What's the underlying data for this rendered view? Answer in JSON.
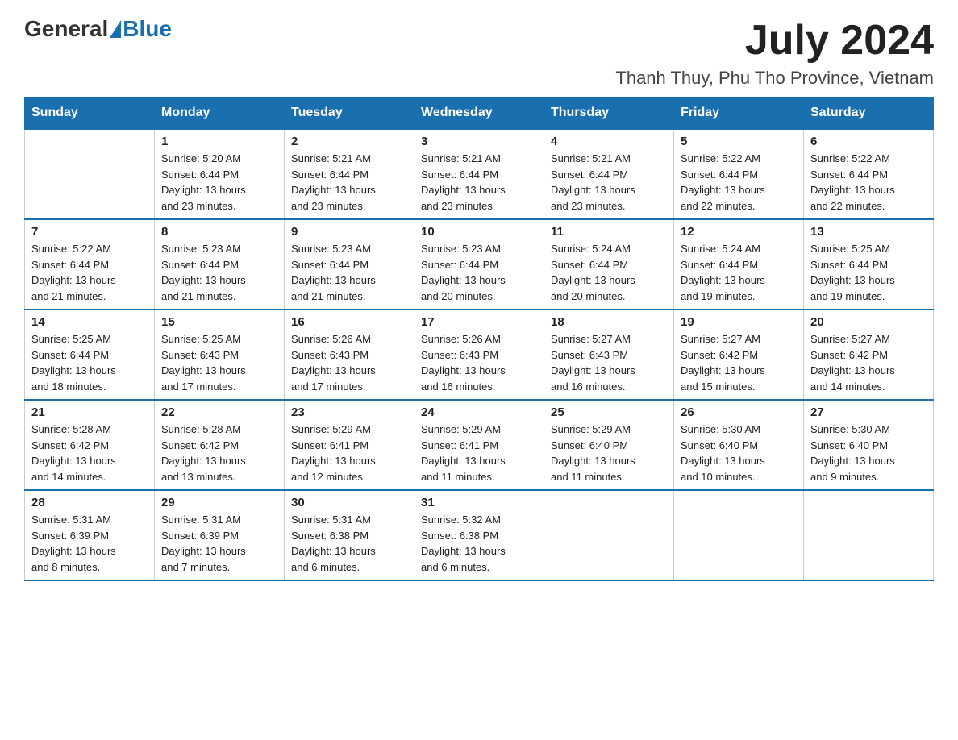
{
  "header": {
    "logo_general": "General",
    "logo_blue": "Blue",
    "month_year": "July 2024",
    "location": "Thanh Thuy, Phu Tho Province, Vietnam"
  },
  "days_of_week": [
    "Sunday",
    "Monday",
    "Tuesday",
    "Wednesday",
    "Thursday",
    "Friday",
    "Saturday"
  ],
  "weeks": [
    [
      {
        "day": "",
        "info": ""
      },
      {
        "day": "1",
        "info": "Sunrise: 5:20 AM\nSunset: 6:44 PM\nDaylight: 13 hours\nand 23 minutes."
      },
      {
        "day": "2",
        "info": "Sunrise: 5:21 AM\nSunset: 6:44 PM\nDaylight: 13 hours\nand 23 minutes."
      },
      {
        "day": "3",
        "info": "Sunrise: 5:21 AM\nSunset: 6:44 PM\nDaylight: 13 hours\nand 23 minutes."
      },
      {
        "day": "4",
        "info": "Sunrise: 5:21 AM\nSunset: 6:44 PM\nDaylight: 13 hours\nand 23 minutes."
      },
      {
        "day": "5",
        "info": "Sunrise: 5:22 AM\nSunset: 6:44 PM\nDaylight: 13 hours\nand 22 minutes."
      },
      {
        "day": "6",
        "info": "Sunrise: 5:22 AM\nSunset: 6:44 PM\nDaylight: 13 hours\nand 22 minutes."
      }
    ],
    [
      {
        "day": "7",
        "info": "Sunrise: 5:22 AM\nSunset: 6:44 PM\nDaylight: 13 hours\nand 21 minutes."
      },
      {
        "day": "8",
        "info": "Sunrise: 5:23 AM\nSunset: 6:44 PM\nDaylight: 13 hours\nand 21 minutes."
      },
      {
        "day": "9",
        "info": "Sunrise: 5:23 AM\nSunset: 6:44 PM\nDaylight: 13 hours\nand 21 minutes."
      },
      {
        "day": "10",
        "info": "Sunrise: 5:23 AM\nSunset: 6:44 PM\nDaylight: 13 hours\nand 20 minutes."
      },
      {
        "day": "11",
        "info": "Sunrise: 5:24 AM\nSunset: 6:44 PM\nDaylight: 13 hours\nand 20 minutes."
      },
      {
        "day": "12",
        "info": "Sunrise: 5:24 AM\nSunset: 6:44 PM\nDaylight: 13 hours\nand 19 minutes."
      },
      {
        "day": "13",
        "info": "Sunrise: 5:25 AM\nSunset: 6:44 PM\nDaylight: 13 hours\nand 19 minutes."
      }
    ],
    [
      {
        "day": "14",
        "info": "Sunrise: 5:25 AM\nSunset: 6:44 PM\nDaylight: 13 hours\nand 18 minutes."
      },
      {
        "day": "15",
        "info": "Sunrise: 5:25 AM\nSunset: 6:43 PM\nDaylight: 13 hours\nand 17 minutes."
      },
      {
        "day": "16",
        "info": "Sunrise: 5:26 AM\nSunset: 6:43 PM\nDaylight: 13 hours\nand 17 minutes."
      },
      {
        "day": "17",
        "info": "Sunrise: 5:26 AM\nSunset: 6:43 PM\nDaylight: 13 hours\nand 16 minutes."
      },
      {
        "day": "18",
        "info": "Sunrise: 5:27 AM\nSunset: 6:43 PM\nDaylight: 13 hours\nand 16 minutes."
      },
      {
        "day": "19",
        "info": "Sunrise: 5:27 AM\nSunset: 6:42 PM\nDaylight: 13 hours\nand 15 minutes."
      },
      {
        "day": "20",
        "info": "Sunrise: 5:27 AM\nSunset: 6:42 PM\nDaylight: 13 hours\nand 14 minutes."
      }
    ],
    [
      {
        "day": "21",
        "info": "Sunrise: 5:28 AM\nSunset: 6:42 PM\nDaylight: 13 hours\nand 14 minutes."
      },
      {
        "day": "22",
        "info": "Sunrise: 5:28 AM\nSunset: 6:42 PM\nDaylight: 13 hours\nand 13 minutes."
      },
      {
        "day": "23",
        "info": "Sunrise: 5:29 AM\nSunset: 6:41 PM\nDaylight: 13 hours\nand 12 minutes."
      },
      {
        "day": "24",
        "info": "Sunrise: 5:29 AM\nSunset: 6:41 PM\nDaylight: 13 hours\nand 11 minutes."
      },
      {
        "day": "25",
        "info": "Sunrise: 5:29 AM\nSunset: 6:40 PM\nDaylight: 13 hours\nand 11 minutes."
      },
      {
        "day": "26",
        "info": "Sunrise: 5:30 AM\nSunset: 6:40 PM\nDaylight: 13 hours\nand 10 minutes."
      },
      {
        "day": "27",
        "info": "Sunrise: 5:30 AM\nSunset: 6:40 PM\nDaylight: 13 hours\nand 9 minutes."
      }
    ],
    [
      {
        "day": "28",
        "info": "Sunrise: 5:31 AM\nSunset: 6:39 PM\nDaylight: 13 hours\nand 8 minutes."
      },
      {
        "day": "29",
        "info": "Sunrise: 5:31 AM\nSunset: 6:39 PM\nDaylight: 13 hours\nand 7 minutes."
      },
      {
        "day": "30",
        "info": "Sunrise: 5:31 AM\nSunset: 6:38 PM\nDaylight: 13 hours\nand 6 minutes."
      },
      {
        "day": "31",
        "info": "Sunrise: 5:32 AM\nSunset: 6:38 PM\nDaylight: 13 hours\nand 6 minutes."
      },
      {
        "day": "",
        "info": ""
      },
      {
        "day": "",
        "info": ""
      },
      {
        "day": "",
        "info": ""
      }
    ]
  ]
}
